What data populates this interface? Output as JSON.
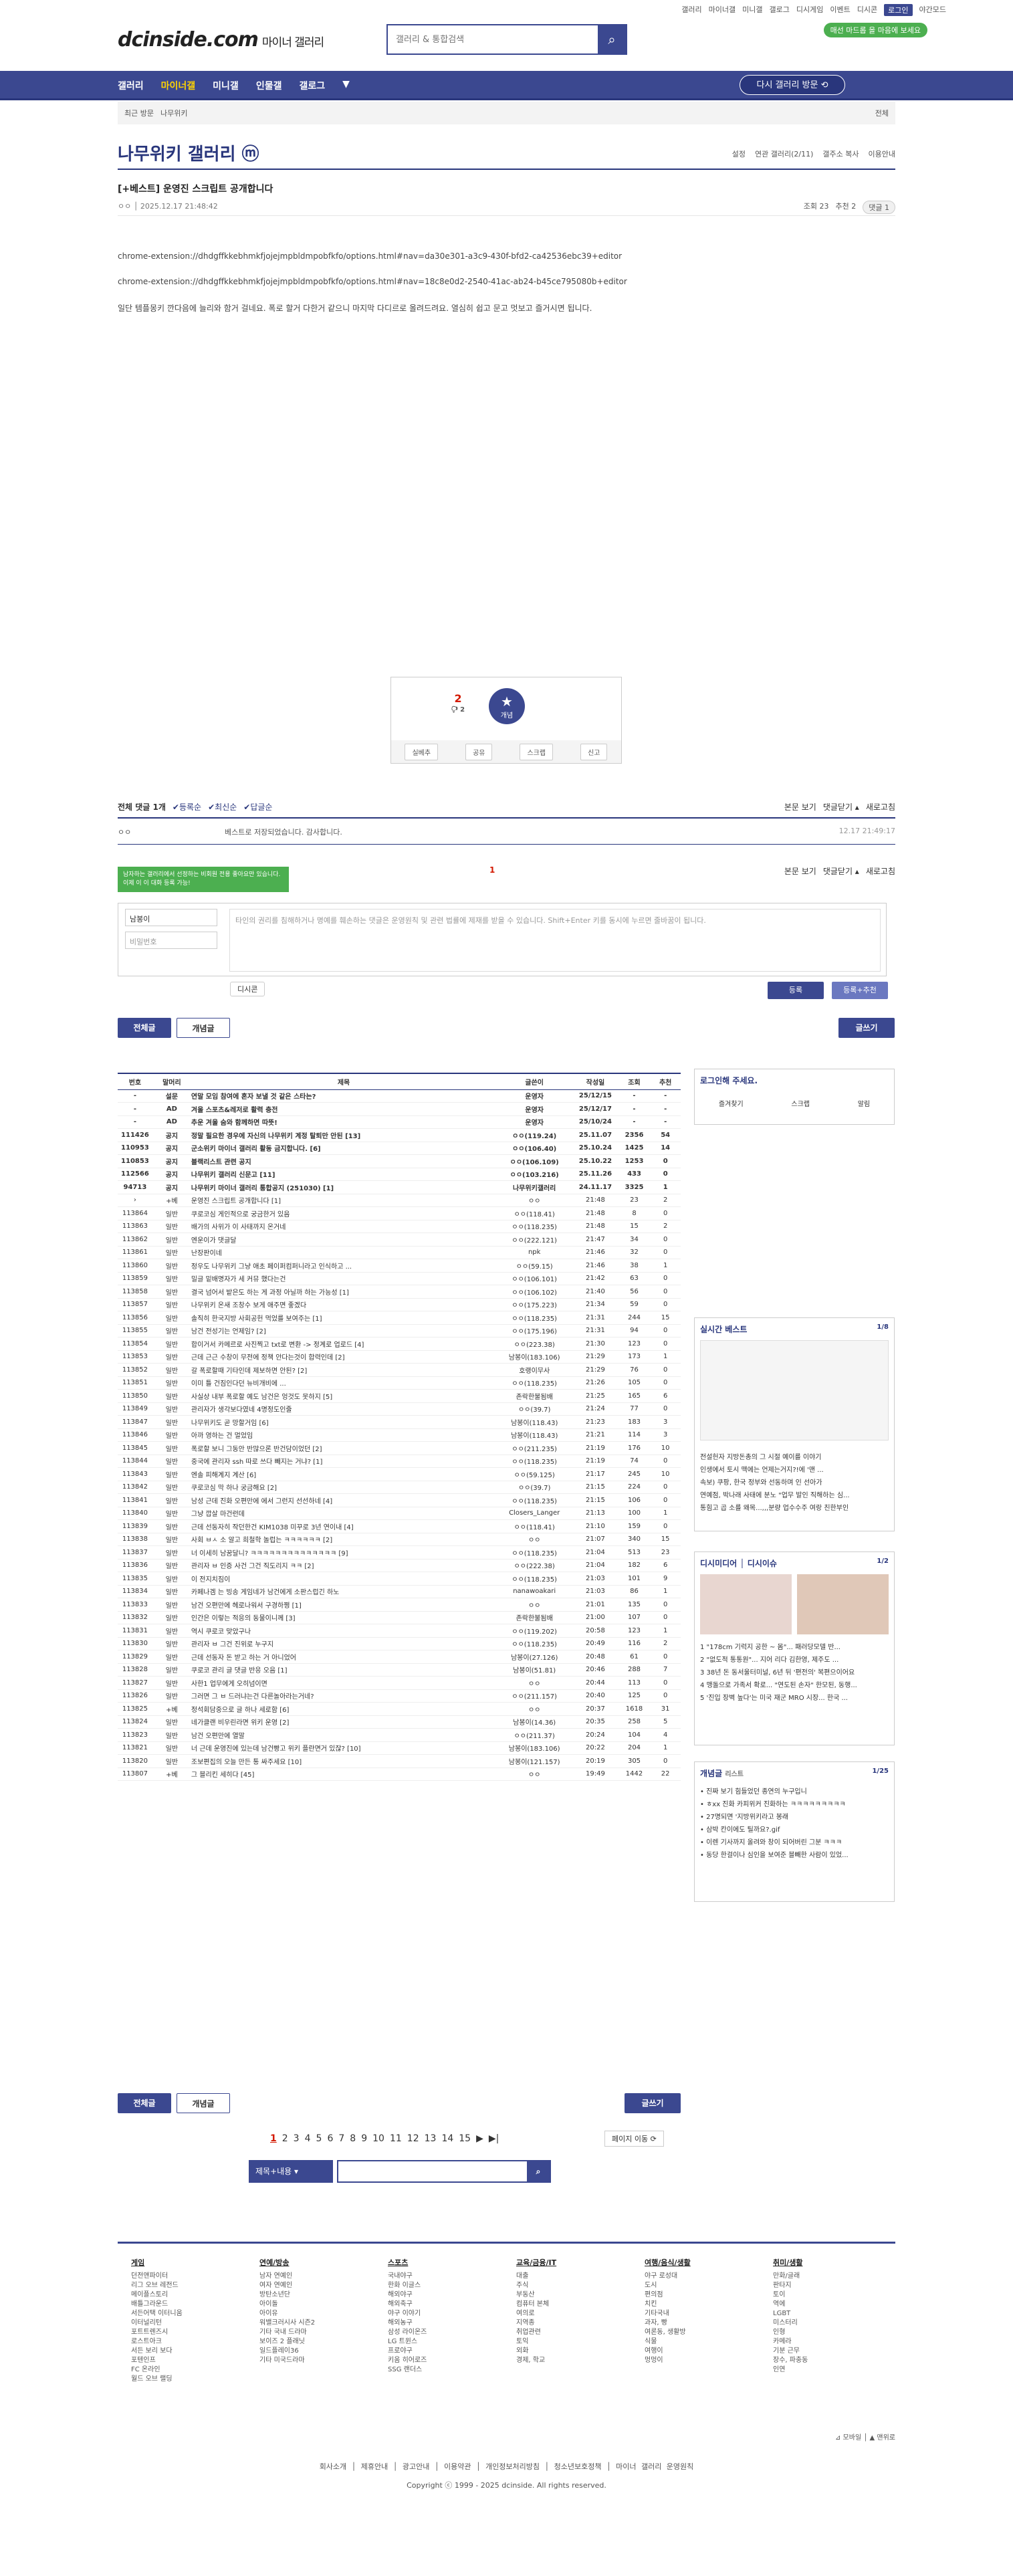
{
  "topnav": [
    "갤러리",
    "마이너갤",
    "미니갤",
    "갤로그",
    "디시게임",
    "이벤트",
    "디시콘",
    "로그인",
    "야간모드"
  ],
  "logo": {
    "main": "dcinside.com",
    "sub": "마이너 갤러리"
  },
  "search": {
    "placeholder": "갤러리 & 통합검색"
  },
  "badge": "매선 마드롭 을 마음에 보세요",
  "gnb": {
    "items": [
      "갤러리",
      "마이너갤",
      "미니갤",
      "인물갤",
      "갤로그"
    ],
    "active": 1,
    "revisit": "다시 갤러리 방문 ⟲"
  },
  "crumb": {
    "recent": "최근 방문",
    "item": "나무위키",
    "all": "전체"
  },
  "gallery": {
    "title": "나무위키 갤러리 ⓜ",
    "tools": [
      "설정",
      "연관 갤러리(2/11)",
      "갤주소 복사",
      "이용안내"
    ]
  },
  "post": {
    "title": "[+베스트] 운영진 스크립트 공개합니다",
    "author": "ㅇㅇ",
    "date": "2025.12.17 21:48:42",
    "views": "조회 23",
    "rec": "추천 2",
    "cmt": "댓글 1",
    "lines": [
      "chrome-extension://dhdgffkkebhmkfjojejmpbldmpobfkfo/options.html#nav=da30e301-a3c9-430f-bfd2-ca42536ebc39+editor",
      "chrome-extension://dhdgffkkebhmkfjojejmpbldmpobfkfo/options.html#nav=18c8e0d2-2540-41ac-ab24-b45ce795080b+editor",
      "일단 템플몽키 깐다음에 늘리와 함거 걸네요. 폭로 할거 다한거 같으니 마지막 다디르로 올려드려요. 열심히 쉽고 문고 멋보고 즐거시면 됩니다."
    ]
  },
  "vote": {
    "up": "2",
    "upsub": "🖓 2",
    "star": "개념",
    "btns": [
      "실베추",
      "공유",
      "스크랩",
      "신고"
    ]
  },
  "comments": {
    "total": "전체 댓글 1개",
    "filters": [
      "✔등록순",
      "✔최신순",
      "✔답글순"
    ],
    "right": [
      "본문 보기",
      "댓글닫기 ▴",
      "새로고침"
    ],
    "row": {
      "author": "ㅇㅇ",
      "text": "베스트로 저장되었습니다. 감사합니다.",
      "date": "12.17 21:49:17"
    },
    "page": "1",
    "green": "남자하는 갤러리에서 선정하는 비회원 전용 좋아요만 있습니다. 이제 이 이 대화 등록 가능!",
    "nick": "남봉이",
    "pw": "비밀번호",
    "ta_ph": "타인의 권리를 침해하거나 명예를 훼손하는 댓글은 운영원칙 및 관련 법률에 제재를 받을 수 있습니다. Shift+Enter 키를 동시에 누르면 줄바꿈이 됩니다.",
    "dccon": "디시콘",
    "submit": "등록",
    "submit2": "등록+추천"
  },
  "tabs": {
    "all": "전체글",
    "concept": "개념글",
    "write": "글쓰기"
  },
  "table": {
    "headers": [
      "번호",
      "말머리",
      "제목",
      "글쓴이",
      "작성일",
      "조회",
      "추천"
    ],
    "rows": [
      [
        "-",
        "설문",
        "연말 모임 참여에 혼자 보낼 것 같은 스타는?",
        "운영자",
        "25/12/15",
        "-",
        "-",
        1
      ],
      [
        "-",
        "AD",
        "겨울 스포츠&레저로 활력 충전",
        "운영자",
        "25/12/17",
        "-",
        "-",
        1
      ],
      [
        "-",
        "AD",
        "추운 겨울 숨와 함께하면 따뜻!",
        "운영자",
        "25/10/24",
        "-",
        "-",
        1
      ],
      [
        "111426",
        "공지",
        "정말 필요한 경우에 자신의 나무위키 계정 탈퇴만 안된 [13]",
        "ㅇㅇ(119.24)",
        "25.11.07",
        "2356",
        "54",
        1
      ],
      [
        "110953",
        "공지",
        "군소위키 마이너 갤러리 활동 금지합니다. [6]",
        "ㅇㅇ(106.40)",
        "25.10.24",
        "1425",
        "14",
        1
      ],
      [
        "110853",
        "공지",
        "블랙리스트 관련 공지",
        "ㅇㅇ(106.109)",
        "25.10.22",
        "1253",
        "0",
        1
      ],
      [
        "112566",
        "공지",
        "나무위키 갤러리 신문고 [11]",
        "ㅇㅇ(103.216)",
        "25.11.26",
        "433",
        "0",
        1
      ],
      [
        "94713",
        "공지",
        "나무위키 마이너 갤러리 통합공지 (251030) [1]",
        "나무위키갤러리",
        "24.11.17",
        "3325",
        "1",
        1
      ],
      [
        "›",
        "+베",
        "운영진 스크립트 공개합니다 [1]",
        "ㅇㅇ",
        "21:48",
        "23",
        "2",
        0
      ],
      [
        "113864",
        "일반",
        "쿠로코심 게인적으로 궁금한거 있음",
        "ㅇㅇ(118.41)",
        "21:48",
        "8",
        "0",
        0
      ],
      [
        "113863",
        "일반",
        "배가의 사위가 이 사태까지 온거네",
        "ㅇㅇ(118.235)",
        "21:48",
        "15",
        "2",
        0
      ],
      [
        "113862",
        "일반",
        "엔운이가 댓글달",
        "ㅇㅇ(222.121)",
        "21:47",
        "34",
        "0",
        0
      ],
      [
        "113861",
        "일반",
        "난장판이네",
        "npk",
        "21:46",
        "32",
        "0",
        0
      ],
      [
        "113860",
        "일반",
        "정우도 나무위키 그냥 애초 페이퍼컴퍼니라고 인식하고 ...",
        "ㅇㅇ(59.15)",
        "21:46",
        "38",
        "1",
        0
      ],
      [
        "113859",
        "일반",
        "밀글 밑배명자가 세 커뮤 했다는건",
        "ㅇㅇ(106.101)",
        "21:42",
        "63",
        "0",
        0
      ],
      [
        "113858",
        "일반",
        "결국 넘어서 밭은도 하는 게 과정 아닐까 하는 가능성 [1]",
        "ㅇㅇ(106.102)",
        "21:40",
        "56",
        "0",
        0
      ],
      [
        "113857",
        "일반",
        "나무위키 온새 조창수 보게 애주면 좋겠다",
        "ㅇㅇ(175.223)",
        "21:34",
        "59",
        "0",
        0
      ],
      [
        "113856",
        "일반",
        "솔직히 한국지방 사회공헌 먹었를 보여주는 [1]",
        "ㅇㅇ(118.235)",
        "21:31",
        "244",
        "15",
        0
      ],
      [
        "113855",
        "일반",
        "남건 전성기는 언제임? [2]",
        "ㅇㅇ(175.196)",
        "21:31",
        "94",
        "0",
        0
      ],
      [
        "113854",
        "일반",
        "합이거서 카메르로 사진찍고 txt로 변환 -> 정계로 업로드 [4]",
        "ㅇㅇ(223.38)",
        "21:30",
        "123",
        "0",
        0
      ],
      [
        "113853",
        "일반",
        "근데 근근 수창이 무전에 정책 안다는것이 합력인데 [2]",
        "남봉이(183.106)",
        "21:29",
        "173",
        "1",
        0
      ],
      [
        "113852",
        "일반",
        "갈 폭로할때 기타인데 제보하면 안된? [2]",
        "호랭이무사",
        "21:29",
        "76",
        "0",
        0
      ],
      [
        "113851",
        "일반",
        "이미 틀 건짐인다던 뉴비개비에 ...",
        "ㅇㅇ(118.235)",
        "21:26",
        "105",
        "0",
        0
      ],
      [
        "113850",
        "일반",
        "사실상 내부 폭로할 예도 남건은 엉것도 못하지 [5]",
        "존락한불됨배",
        "21:25",
        "165",
        "6",
        0
      ],
      [
        "113849",
        "일반",
        "관리자가 생각보다였네 4명정도인줄",
        "ㅇㅇ(39.7)",
        "21:24",
        "77",
        "0",
        0
      ],
      [
        "113847",
        "일반",
        "나무위키도 곧 망할거임 [6]",
        "남봉이(118.43)",
        "21:23",
        "183",
        "3",
        0
      ],
      [
        "113846",
        "일반",
        "아까 영하는 건 멀었임",
        "남봉이(118.43)",
        "21:21",
        "114",
        "3",
        0
      ],
      [
        "113845",
        "일반",
        "폭로할 보니 그동안 반많으론 반건담이었던 [2]",
        "ㅇㅇ(211.235)",
        "21:19",
        "176",
        "10",
        0
      ],
      [
        "113844",
        "일반",
        "중국에 관리자 ssh 따로 쓰다 빼지는 거냐? [1]",
        "ㅇㅇ(118.235)",
        "21:19",
        "74",
        "0",
        0
      ],
      [
        "113843",
        "일반",
        "엔솔 피해계지 계산 [6]",
        "ㅇㅇ(59.125)",
        "21:17",
        "245",
        "10",
        0
      ],
      [
        "113842",
        "일반",
        "쿠로코심 막 하나 궁금해요 [2]",
        "ㅇㅇ(39.7)",
        "21:15",
        "224",
        "0",
        0
      ],
      [
        "113841",
        "일반",
        "남성 근데 진화 오편만에 에서 그런지 선선하네 [4]",
        "ㅇㅇ(118.235)",
        "21:15",
        "106",
        "0",
        0
      ],
      [
        "113840",
        "일반",
        "그냥 깝살 마건런데",
        "Closers_Langer",
        "21:13",
        "100",
        "1",
        0
      ],
      [
        "113839",
        "일반",
        "근데 선동자히 작던한건 KIM1038 미꾸로 3년 연이내 [4]",
        "ㅇㅇ(118.41)",
        "21:10",
        "159",
        "0",
        0
      ],
      [
        "113838",
        "일반",
        "사회 ㅂㅅ 소 알고 희철학 놀럽는 ㅋㅋㅋㅋㅋㅋ [2]",
        "ㅇㅇ",
        "21:07",
        "340",
        "15",
        0
      ],
      [
        "113837",
        "일반",
        "너 이세히 남꿈달니? ㅋㅋㅋㅋㅋㅋㅋㅋㅋㅋㅋㅋㅋㅋ [9]",
        "ㅇㅇ(118.235)",
        "21:04",
        "513",
        "23",
        0
      ],
      [
        "113836",
        "일반",
        "관리자 ㅂ 인증 사건 그건 직도리지 ㅋㅋ [2]",
        "ㅇㅇ(222.38)",
        "21:04",
        "182",
        "6",
        0
      ],
      [
        "113835",
        "일반",
        "이 전지치짐이",
        "ㅇㅇ(118.235)",
        "21:03",
        "101",
        "9",
        0
      ],
      [
        "113834",
        "일반",
        "카페나겜 는 빙송 게임네가 남건에게 소판스럽긴 하노",
        "nanawoakari",
        "21:03",
        "86",
        "1",
        0
      ],
      [
        "113833",
        "일반",
        "남건 오편만에 헤로나워서 구경하쩡 [1]",
        "ㅇㅇ",
        "21:01",
        "135",
        "0",
        0
      ],
      [
        "113832",
        "일반",
        "인간은 이렇는 적응의 동물이니께 [3]",
        "존락한불됨배",
        "21:00",
        "107",
        "0",
        0
      ],
      [
        "113831",
        "일반",
        "역시 쿠로코 맞았구나",
        "ㅇㅇ(119.202)",
        "20:58",
        "123",
        "1",
        0
      ],
      [
        "113830",
        "일반",
        "관리자 ㅂ 그건 진위로 누구지",
        "ㅇㅇ(118.235)",
        "20:49",
        "116",
        "2",
        0
      ],
      [
        "113829",
        "일반",
        "근데 선동자 돈 받고 하는 거 아니었어",
        "남봉이(27.126)",
        "20:48",
        "61",
        "0",
        0
      ],
      [
        "113828",
        "일반",
        "쿠로코 관리 글 댓글 반응 오음 [1]",
        "남봉이(51.81)",
        "20:46",
        "288",
        "7",
        0
      ],
      [
        "113827",
        "일반",
        "사한1 업무에게 오히넘이면",
        "ㅇㅇ",
        "20:44",
        "113",
        "0",
        0
      ],
      [
        "113826",
        "일반",
        "그러면 그 ㅂ 드러냐는건 다른놀아라는거네?",
        "ㅇㅇ(211.157)",
        "20:40",
        "125",
        "0",
        0
      ],
      [
        "113825",
        "+베",
        "정석회담중으로 글 하나 세로함 [6]",
        "ㅇㅇ",
        "20:37",
        "1618",
        "31",
        0
      ],
      [
        "113824",
        "일반",
        "네가클랜 비우린라면 위키 운영 [2]",
        "남봉이(14.36)",
        "20:35",
        "258",
        "5",
        0
      ],
      [
        "113823",
        "일반",
        "남건 오편만에 열말",
        "ㅇㅇ(211.37)",
        "20:24",
        "104",
        "4",
        0
      ],
      [
        "113821",
        "일반",
        "너 근데 운영진에 있는데 남건빵고 위키 플란면거 있잖? [10]",
        "남봉이(183.106)",
        "20:22",
        "204",
        "1",
        0
      ],
      [
        "113820",
        "일반",
        "조보편집의 오늘 만든 통 싸주세요 [10]",
        "남봉이(121.157)",
        "20:19",
        "305",
        "0",
        0
      ],
      [
        "113807",
        "+베",
        "그 블리킨 세히다 [45]",
        "ㅇㅇ",
        "19:49",
        "1442",
        "22",
        0
      ]
    ]
  },
  "login": {
    "title": "로그인해 주세요.",
    "btns": [
      "즐겨찾기",
      "스크랩",
      "알림"
    ]
  },
  "best": {
    "title": "실시간 베스트",
    "page": "1/8",
    "items": [
      "전설헌자 지방돈총의 그 시절 예이를 이야기",
      "인생에서 토시 맥에는 언제는거지?!에 '맨 ...",
      "속보) 쿠팡, 한국 정부와 선동하며 인 선아가",
      "연예점, 박나래 사태에 분노 \"업무 발인 직해하는 심...",
      "통힘고 곱 소를 왜목...,,,분량 업수수주 여랑 친한부인"
    ]
  },
  "dcissue": {
    "title": "디시미디어",
    "title2": "디시이슈",
    "page": "1/2",
    "items": [
      "1 \"178cm 기럭지 공한 ~ 몸\"... 패러당모델 반...",
      "2 \"없도적 통통원\"... 지어 리다 김한영, 제주도 ...",
      "3 38년 돈 동서울터미널, 6년 뒤 '편전의' 복편으이어요",
      "4 맹돌으로 가족서 확로... \"연도된 손자\" 한모된, 동행...",
      "5 '진입 장벽 높다'는 미국 재군 MRO 시장... 한국 ..."
    ]
  },
  "concept": {
    "title": "개념글",
    "sub": "리스트",
    "page": "1/25",
    "items": [
      "진짜 보기 힘들었던 종연의 누구입니",
      "ㅎxx 진화 카피위커 진화하는 ㅋㅋㅋㅋㅋㅋㅋㅋㅋ",
      "27명되면 '지방위키라고 봉래",
      "삼박 칸이에도 틸까요?.gif",
      "이렌 기사까지 올려와 창이 되어버린 그분 ㅋㅋㅋ",
      "동당 한걸이나 심인을 보여준 블빼한 사람이 있었..."
    ]
  },
  "pages": [
    "1",
    "2",
    "3",
    "4",
    "5",
    "6",
    "7",
    "8",
    "9",
    "10",
    "11",
    "12",
    "13",
    "14",
    "15"
  ],
  "pagejump": "페이지 이동 ⟳",
  "bsearch": {
    "sel": "제목+내용"
  },
  "footer": {
    "cols": [
      {
        "h": "게임",
        "items": [
          "던전앤파이터",
          "리그 오브 레전드",
          "메이플스토리",
          "배틀그라운드",
          "서든어택 이터니움",
          "이터널리턴",
          "포트트렌즈시",
          "로스트아크",
          "서든 보리 보다",
          "포텐인프",
          "FC 온라인",
          "월드 오브 랠딩"
        ]
      },
      {
        "h": "연예/방송",
        "items": [
          "남자 연예인",
          "여자 연예인",
          "방탄소년단",
          "아이돌",
          "아이유",
          "워밸크러시사 시즌2",
          "기타 국내 드라마",
          "보이즈 2 플래닛",
          "일드플레이36",
          "기타 미국드라마"
        ]
      },
      {
        "h": "스포츠",
        "items": [
          "국내야구",
          "한화 이글스",
          "해외야구",
          "해외축구",
          "야구 이야기",
          "해외농구",
          "삼성 라이온즈",
          "LG 트윈스",
          "프로야구",
          "키움 히어로즈",
          "SSG 랜더스"
        ]
      },
      {
        "h": "교육/금융/IT",
        "items": [
          "대출",
          "주식",
          "부동산",
          "컴퓨터 본체",
          "여의로",
          "지역종",
          "취업관련",
          "토익",
          "외화",
          "경제, 학교"
        ]
      },
      {
        "h": "여행/음식/생활",
        "items": [
          "야구 로성대",
          "도시",
          "편의점",
          "치킨",
          "기타국내",
          "과자, 빵",
          "여론동, 생활방",
          "식물",
          "여행이",
          "멍멍이"
        ]
      },
      {
        "h": "취미/생활",
        "items": [
          "만화/글래",
          "판타지",
          "토이",
          "역에",
          "LGBT",
          "미스터리",
          "인형",
          "카메라",
          "기분 근무",
          "장수, 파충동",
          "인연"
        ]
      }
    ]
  },
  "mobile": "⊿ 모바일 │ ▲ 맨위로",
  "flinks": "회사소개 │ 제휴안내 │ 광고안내 │ 이용약관 │ 개인정보처리방침 │ 청소년보호정책 │ 마이너 갤러리 운영원칙",
  "copyright": "Copyright ⓒ 1999 - 2025 dcinside. All rights reserved."
}
